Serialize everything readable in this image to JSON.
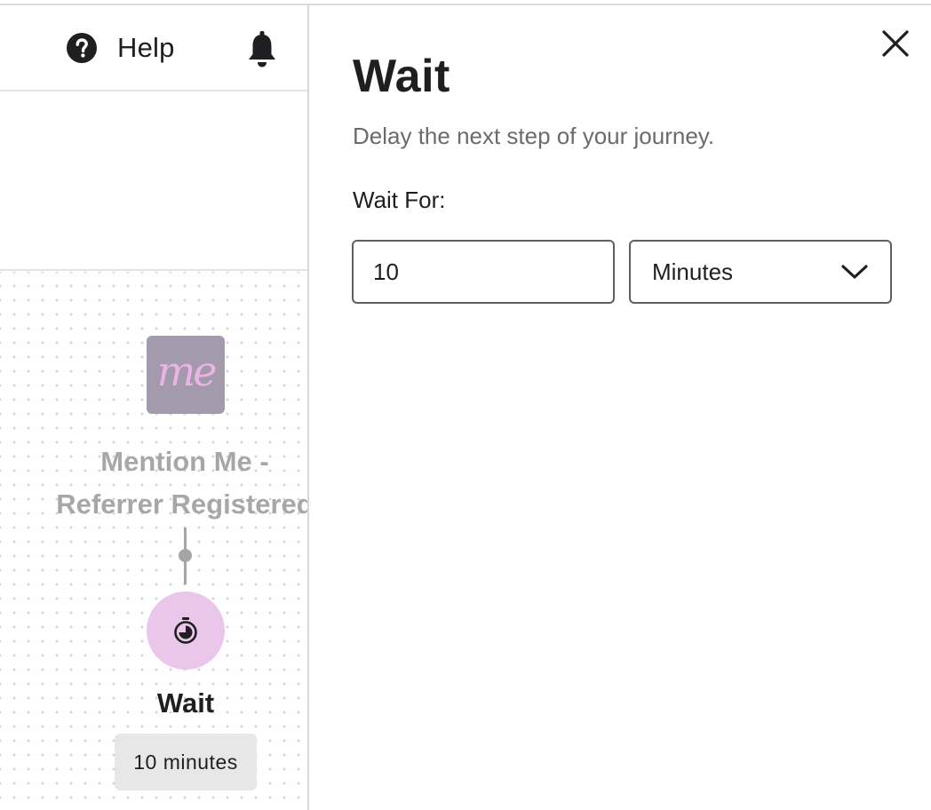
{
  "topbar": {
    "help_label": "Help",
    "help_icon": "question-circle-icon",
    "bell_icon": "bell-icon"
  },
  "canvas": {
    "trigger": {
      "logo_text": "me",
      "logo_color": "#a39aae",
      "title_line1": "Mention Me -",
      "title_line2": "Referrer Registered"
    },
    "wait_node": {
      "icon": "timer-icon",
      "label": "Wait",
      "badge": "10 minutes",
      "color": "#e9c6ea"
    }
  },
  "panel": {
    "close_icon": "close-icon",
    "title": "Wait",
    "description": "Delay the next step of your journey.",
    "wait_for_label": "Wait For:",
    "amount_value": "10",
    "unit_value": "Minutes"
  }
}
